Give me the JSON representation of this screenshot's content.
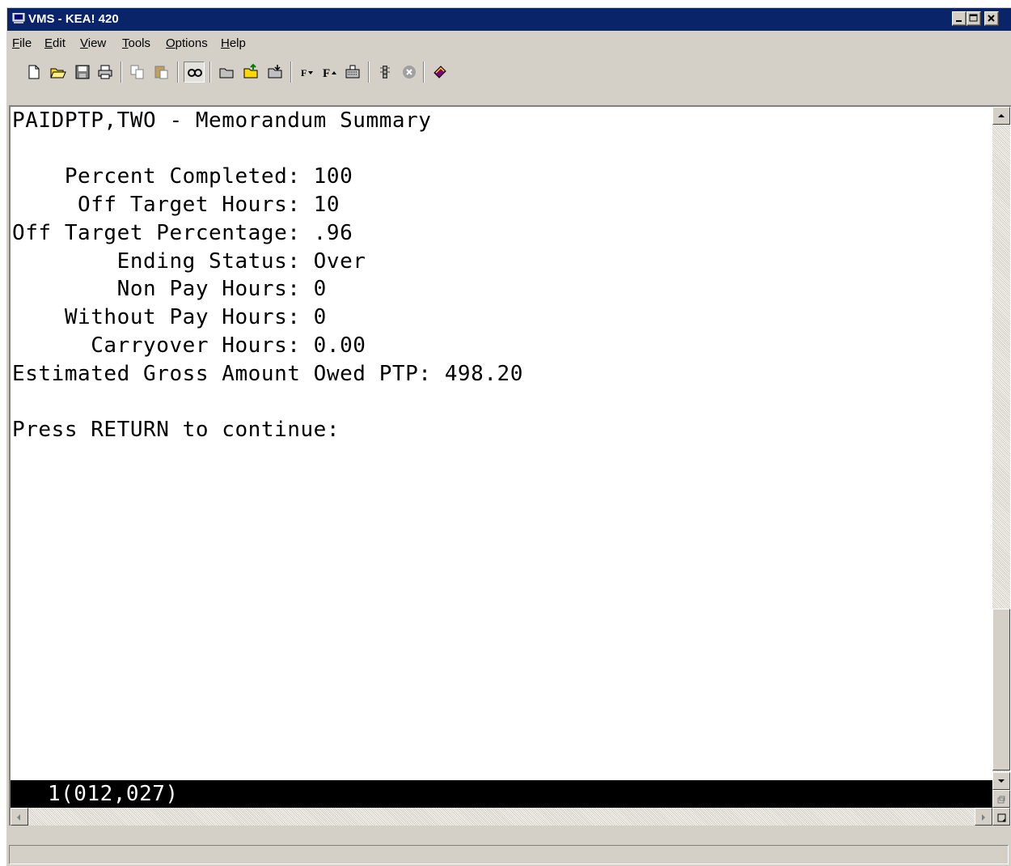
{
  "window": {
    "title": "VMS - KEA! 420"
  },
  "menu": [
    {
      "label": "File",
      "hotkey": "F",
      "rest": "ile"
    },
    {
      "label": "Edit",
      "hotkey": "E",
      "rest": "dit"
    },
    {
      "label": "View",
      "hotkey": "V",
      "rest": "iew"
    },
    {
      "label": "Tools",
      "hotkey": "T",
      "rest": "ools"
    },
    {
      "label": "Options",
      "hotkey": "O",
      "rest": "ptions"
    },
    {
      "label": "Help",
      "hotkey": "H",
      "rest": "elp"
    }
  ],
  "toolbar": {
    "buttons": [
      "new-icon",
      "open-icon",
      "save-icon",
      "print-icon",
      "copy-icon",
      "paste-icon",
      "connect-icon",
      "folder-icon",
      "folder-send-icon",
      "folder-receive-icon",
      "font-down-icon",
      "font-up-icon",
      "keyboard-icon",
      "traffic-light-icon",
      "stop-icon",
      "book-icon"
    ]
  },
  "terminal": {
    "lines": [
      "PAIDPTP,TWO - Memorandum Summary",
      "",
      "    Percent Completed: 100",
      "     Off Target Hours: 10",
      "Off Target Percentage: .96",
      "        Ending Status: Over",
      "        Non Pay Hours: 0",
      "    Without Pay Hours: 0",
      "      Carryover Hours: 0.00",
      "Estimated Gross Amount Owed PTP: 498.20",
      "",
      "Press RETURN to continue:"
    ],
    "status_line": "1(012,027)"
  },
  "colors": {
    "titlebar": "#0a246a",
    "chrome": "#d4d0c8",
    "terminal_bg": "#ffffff",
    "status_bg": "#000000"
  }
}
